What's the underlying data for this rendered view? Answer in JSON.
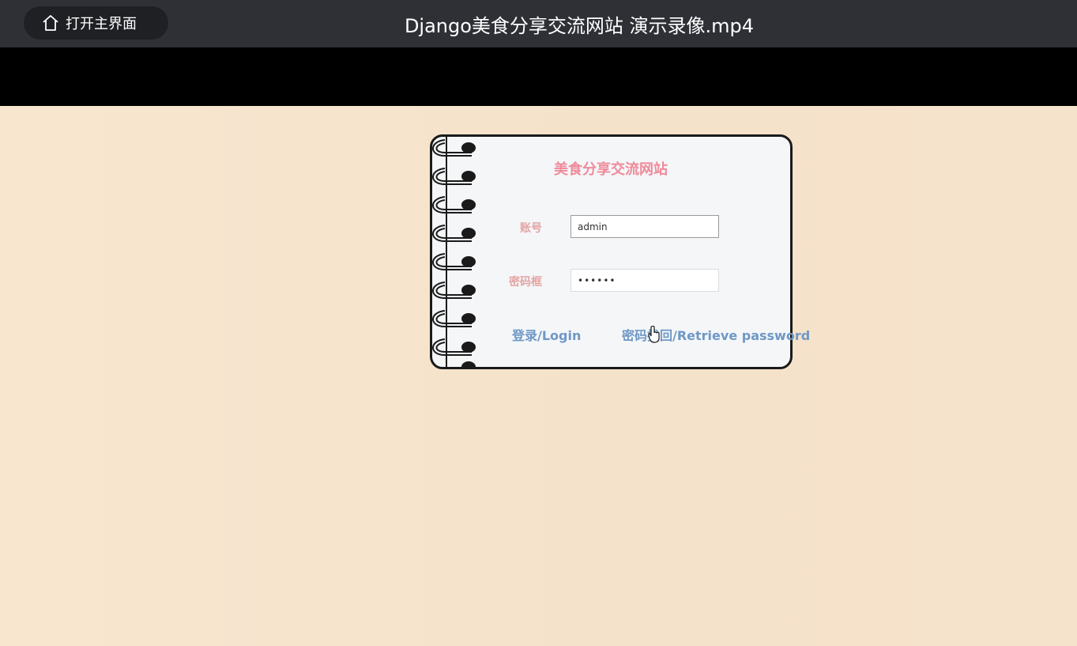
{
  "player": {
    "home_button_label": "打开主界面",
    "video_title": "Django美食分享交流网站 演示录像.mp4"
  },
  "login": {
    "site_title": "美食分享交流网站",
    "account_label": "账号",
    "account_value": "admin",
    "password_label": "密码框",
    "password_value": "••••••",
    "login_button": "登录/Login",
    "retrieve_button": "密码找回/Retrieve password"
  },
  "icons": {
    "home": "home-icon",
    "pointer": "hand-pointer-icon",
    "rings": "spiral-binding-icon"
  },
  "colors": {
    "title_pink": "#f08a9a",
    "label_pink": "#e4a4a4",
    "link_blue": "#6f98c6",
    "page_bg": "#f6e4cd"
  }
}
